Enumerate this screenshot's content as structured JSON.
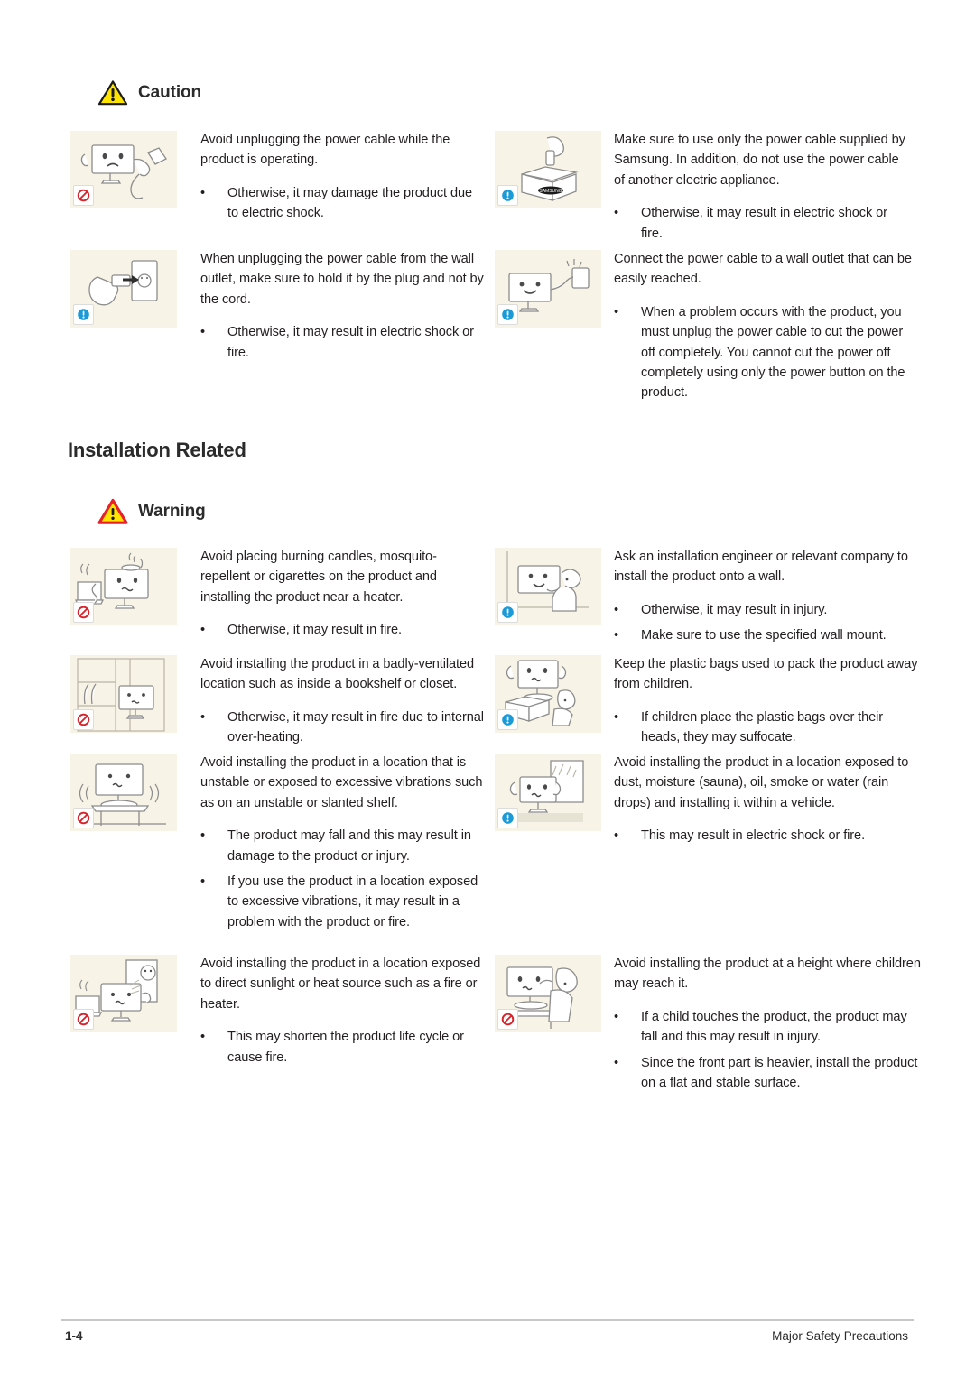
{
  "page": {
    "footer_page_number": "1-4",
    "footer_chapter": "Major Safety Precautions",
    "colors": {
      "caution_triangle_fill": "#ffe400",
      "caution_triangle_stroke": "#1a1a1a",
      "warning_triangle_fill": "#ffe400",
      "warning_triangle_stroke": "#e8202a",
      "prohibit_badge": "#d8232a",
      "info_badge": "#1a9ad7",
      "thumb_background": "#f7f3e6",
      "text": "#231f20"
    }
  },
  "caution_section": {
    "alert_label": "Caution",
    "alert_icon": "warning-triangle-icon",
    "items": [
      {
        "badge": "prohibited-icon",
        "illustration": "monitor-unplugging-power-cable",
        "lead": "Avoid unplugging the power cable while the product is operating.",
        "bullets": [
          "Otherwise, it may damage the product due to electric shock."
        ]
      },
      {
        "badge": "info-icon",
        "illustration": "hand-pulling-plug-from-wall-outlet",
        "lead": "When unplugging the power cable from the wall outlet, make sure to hold it by the plug and not by the cord.",
        "bullets": [
          "Otherwise, it may result in electric shock or fire."
        ]
      },
      {
        "badge": "info-icon",
        "illustration": "power-cable-in-samsung-box",
        "lead": "Make sure to use only the power cable supplied by Samsung. In addition, do not use the power cable of another electric appliance.",
        "bullets": [
          "Otherwise, it may result in electric shock or fire."
        ]
      },
      {
        "badge": "info-icon",
        "illustration": "monitor-connected-to-wall-outlet",
        "lead": "Connect the power cable to a wall outlet that can be easily reached.",
        "bullets": [
          "When a problem occurs with the product, you must unplug the power cable to cut the power off completely. You cannot cut the power off completely using only the power button on the product."
        ]
      }
    ]
  },
  "installation_section": {
    "title": "Installation Related",
    "alert_label": "Warning",
    "alert_icon": "warning-triangle-icon",
    "items": [
      {
        "badge": "prohibited-icon",
        "illustration": "monitor-near-candles-and-heater",
        "lead": "Avoid placing burning candles,  mosquito-repellent or cigarettes on the product and installing the product near a heater.",
        "bullets": [
          "Otherwise, it may result in fire."
        ]
      },
      {
        "badge": "prohibited-icon",
        "illustration": "monitor-inside-bookshelf",
        "lead": "Avoid installing the product in a badly-ventilated location such as inside a bookshelf or closet.",
        "bullets": [
          "Otherwise, it may result in fire due to internal over-heating."
        ]
      },
      {
        "badge": "prohibited-icon",
        "illustration": "monitor-on-unstable-shelf",
        "lead": "Avoid installing the product in a location that is unstable or exposed to excessive vibrations such as on an unstable or slanted shelf.",
        "bullets": [
          "The product may fall and this may result in damage to the product or injury.",
          "If you use the product in a location exposed to excessive vibrations, it may result in a problem with the product or fire."
        ]
      },
      {
        "badge": "prohibited-icon",
        "illustration": "monitor-in-sunlight-near-heater",
        "lead": "Avoid installing the product in a location exposed to direct sunlight or heat source such as a fire or heater.",
        "bullets": [
          "This may shorten the product life cycle or cause fire."
        ]
      },
      {
        "badge": "info-icon",
        "illustration": "engineer-installing-monitor-on-wall",
        "lead": "Ask an installation engineer or relevant company to install the product onto a wall.",
        "bullets": [
          "Otherwise, it may result in injury.",
          "Make sure to use the specified wall mount."
        ]
      },
      {
        "badge": "info-icon",
        "illustration": "child-with-plastic-bags-near-monitor",
        "lead": "Keep the plastic bags used to pack the product away from children.",
        "bullets": [
          " If children place the plastic bags over their heads, they may suffocate."
        ]
      },
      {
        "badge": "info-icon",
        "illustration": "monitor-exposed-to-rain-and-dust",
        "lead": "Avoid installing the product in a location exposed to dust, moisture (sauna), oil, smoke or water (rain drops) and installing it within a vehicle.",
        "bullets": [
          "This may result in electric shock or fire."
        ]
      },
      {
        "badge": "prohibited-icon",
        "illustration": "child-reaching-for-monitor",
        "lead": "Avoid installing the product at a height where children may reach it.",
        "bullets": [
          "If a child touches the product, the product may fall and this may result in injury.",
          "Since the front part is heavier, install the product on a flat and stable surface."
        ]
      }
    ]
  }
}
